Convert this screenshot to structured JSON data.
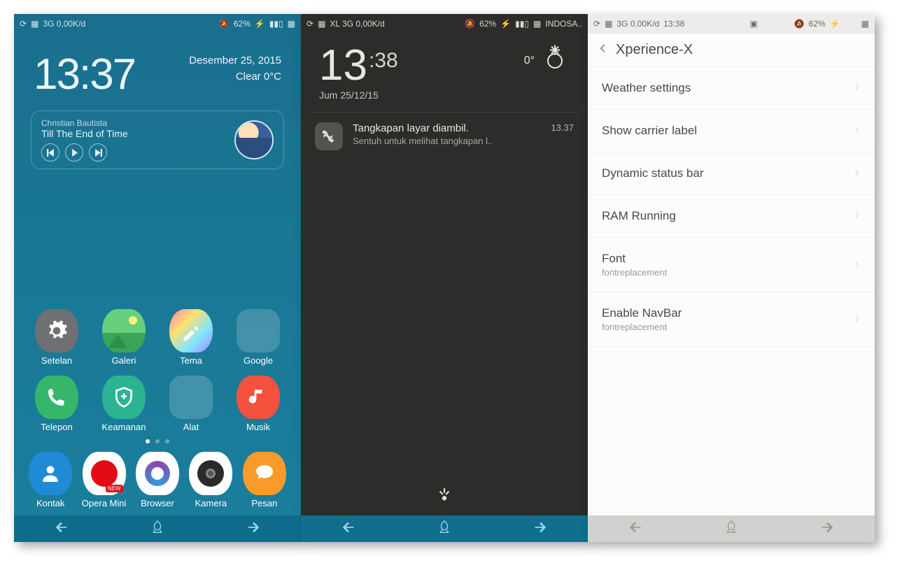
{
  "screen1": {
    "status": {
      "net": "3G 0,00K/d",
      "battery": "62%"
    },
    "clock": "13:37",
    "date": "Desember 25, 2015",
    "weather": "Clear 0°C",
    "music": {
      "artist": "Christian Bautista",
      "title": "Till The End of Time"
    },
    "apps_row1": [
      {
        "label": "Setelan",
        "bg": "#6f7074"
      },
      {
        "label": "Galeri",
        "bg": "#4cc36a"
      },
      {
        "label": "Tema",
        "bg": "#ffffff"
      },
      {
        "label": "Google",
        "bg": "rgba(255,255,255,.18)"
      }
    ],
    "apps_row2": [
      {
        "label": "Telepon",
        "bg": "#35b66b"
      },
      {
        "label": "Keamanan",
        "bg": "#2cb392"
      },
      {
        "label": "Alat",
        "bg": "rgba(255,255,255,.18)"
      },
      {
        "label": "Musik",
        "bg": "#f4513f"
      }
    ],
    "dock": [
      {
        "label": "Kontak",
        "bg": "#1f8bd6"
      },
      {
        "label": "Opera Mini",
        "bg": "#ffffff"
      },
      {
        "label": "Browser",
        "bg": "#ffffff"
      },
      {
        "label": "Kamera",
        "bg": "#ffffff"
      },
      {
        "label": "Pesan",
        "bg": "#f99a2a"
      }
    ]
  },
  "screen2": {
    "status": {
      "carrier": "XL 3G 0,00K/d",
      "battery": "62%",
      "right": "INDOSA.."
    },
    "clock_h": "13",
    "clock_m": ":38",
    "temp": "0°",
    "date": "Jum 25/12/15",
    "notif": {
      "title": "Tangkapan layar diambil.",
      "sub": "Sentuh untuk melihat tangkapan l..",
      "time": "13.37"
    }
  },
  "screen3": {
    "status": {
      "net": "3G 0,00K/d",
      "time": "13:38",
      "battery": "62%"
    },
    "title": "Xperience-X",
    "items": [
      {
        "label": "Weather settings"
      },
      {
        "label": "Show carrier label"
      },
      {
        "label": "Dynamic status bar"
      },
      {
        "label": "RAM Running"
      },
      {
        "label": "Font",
        "sub": "fontreplacement"
      },
      {
        "label": "Enable NavBar",
        "sub": "fontreplacement"
      }
    ]
  }
}
